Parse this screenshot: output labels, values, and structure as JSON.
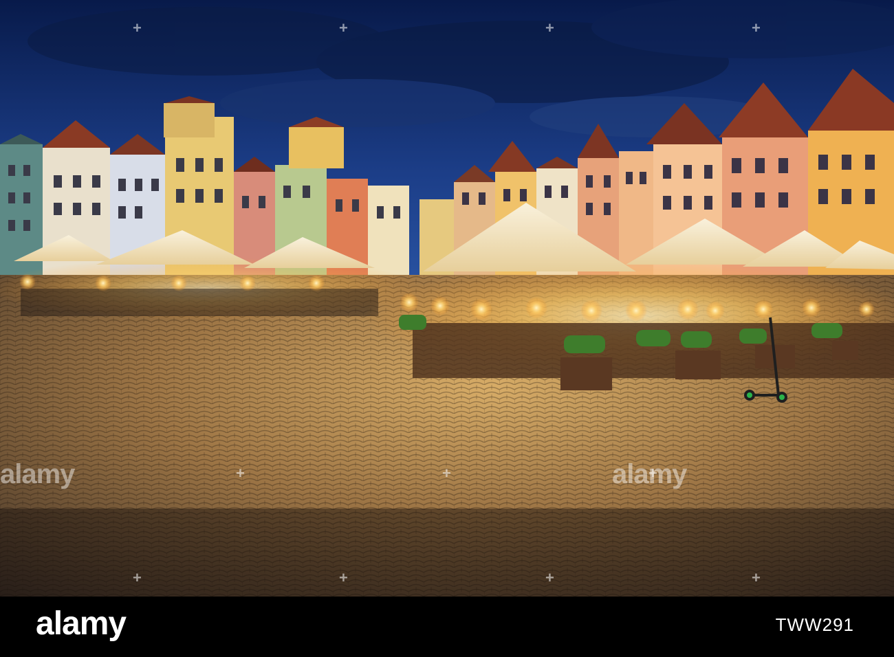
{
  "photo": {
    "description_colors": {
      "sky_top": "#0a1f55",
      "sky_mid": "#1d3f86",
      "cobble_light": "#c49a5b",
      "cobble_dark": "#3a2d24",
      "umbrella": "#f7ecd2",
      "lamp_glow": "#ffd27a"
    }
  },
  "watermarks": {
    "text": "alamy"
  },
  "footer": {
    "logo": "alamy",
    "image_id": "TWW291"
  }
}
